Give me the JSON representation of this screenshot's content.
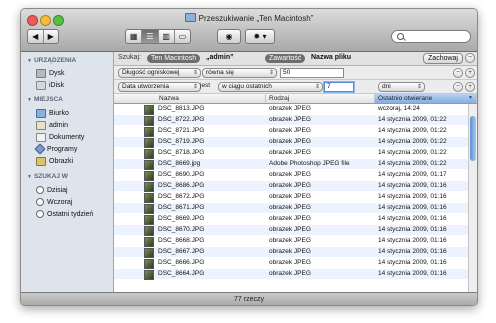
{
  "window": {
    "title": "Przeszukiwanie „Ten Macintosh”"
  },
  "toolbar": {
    "back_icon": "back-arrow",
    "forward_icon": "forward-arrow",
    "view_modes": [
      "icon-view",
      "list-view",
      "column-view",
      "coverflow-view"
    ],
    "selected_view": "list-view",
    "quicklook_icon": "eye-icon",
    "action_icon": "gear-icon",
    "search_placeholder": ""
  },
  "sidebar": {
    "sections": [
      {
        "header": "URZĄDZENIA",
        "items": [
          {
            "label": "Dysk",
            "icon": "hard-disk-icon"
          },
          {
            "label": "iDisk",
            "icon": "idisk-icon"
          }
        ]
      },
      {
        "header": "MIEJSCA",
        "items": [
          {
            "label": "Biurko",
            "icon": "desktop-icon"
          },
          {
            "label": "admin",
            "icon": "home-icon"
          },
          {
            "label": "Dokumenty",
            "icon": "documents-icon"
          },
          {
            "label": "Programy",
            "icon": "applications-icon"
          },
          {
            "label": "Obrazki",
            "icon": "pictures-icon"
          }
        ]
      },
      {
        "header": "SZUKAJ W",
        "items": [
          {
            "label": "Dzisiaj",
            "icon": "clock-icon"
          },
          {
            "label": "Wczoraj",
            "icon": "clock-icon"
          },
          {
            "label": "Ostatni tydzień",
            "icon": "clock-icon"
          }
        ]
      }
    ]
  },
  "scope": {
    "label": "Szukaj:",
    "options": [
      "Ten Macintosh",
      "„admin”"
    ],
    "selected": "Ten Macintosh",
    "attr_options": [
      "Zawartość",
      "Nazwa pliku"
    ],
    "attr_selected": "Zawartość",
    "save_label": "Zachowaj",
    "minus": "−"
  },
  "criteria": [
    {
      "attr": "Długość ogniskowej",
      "op": "równa się",
      "value": "50",
      "unit": ""
    },
    {
      "attr": "Data utworzenia",
      "op": "jest",
      "op2": "w ciągu ostatnich",
      "value": "7",
      "unit": "dni"
    }
  ],
  "criteria_buttons": {
    "minus": "−",
    "plus": "+"
  },
  "columns": [
    "Nazwa",
    "Rodzaj",
    "Ostatnio otwierane"
  ],
  "sorted_column": "Ostatnio otwierane",
  "rows": [
    {
      "name": "DSC_8813.JPG",
      "kind": "obrazek JPEG",
      "opened": "wczoraj, 14:24"
    },
    {
      "name": "DSC_8722.JPG",
      "kind": "obrazek JPEG",
      "opened": "14 stycznia 2009, 01:22"
    },
    {
      "name": "DSC_8721.JPG",
      "kind": "obrazek JPEG",
      "opened": "14 stycznia 2009, 01:22"
    },
    {
      "name": "DSC_8719.JPG",
      "kind": "obrazek JPEG",
      "opened": "14 stycznia 2009, 01:22"
    },
    {
      "name": "DSC_8718.JPG",
      "kind": "obrazek JPEG",
      "opened": "14 stycznia 2009, 01:22"
    },
    {
      "name": "DSC_8669.jpg",
      "kind": "Adobe Photoshop JPEG file",
      "opened": "14 stycznia 2009, 01:22"
    },
    {
      "name": "DSC_8690.JPG",
      "kind": "obrazek JPEG",
      "opened": "14 stycznia 2009, 01:17"
    },
    {
      "name": "DSC_8686.JPG",
      "kind": "obrazek JPEG",
      "opened": "14 stycznia 2009, 01:16"
    },
    {
      "name": "DSC_8672.JPG",
      "kind": "obrazek JPEG",
      "opened": "14 stycznia 2009, 01:16"
    },
    {
      "name": "DSC_8671.JPG",
      "kind": "obrazek JPEG",
      "opened": "14 stycznia 2009, 01:16"
    },
    {
      "name": "DSC_8669.JPG",
      "kind": "obrazek JPEG",
      "opened": "14 stycznia 2009, 01:16"
    },
    {
      "name": "DSC_8670.JPG",
      "kind": "obrazek JPEG",
      "opened": "14 stycznia 2009, 01:16"
    },
    {
      "name": "DSC_8668.JPG",
      "kind": "obrazek JPEG",
      "opened": "14 stycznia 2009, 01:16"
    },
    {
      "name": "DSC_8667.JPG",
      "kind": "obrazek JPEG",
      "opened": "14 stycznia 2009, 01:16"
    },
    {
      "name": "DSC_8666.JPG",
      "kind": "obrazek JPEG",
      "opened": "14 stycznia 2009, 01:16"
    },
    {
      "name": "DSC_8664.JPG",
      "kind": "obrazek JPEG",
      "opened": "14 stycznia 2009, 01:16"
    }
  ],
  "status": {
    "count": "77 rzeczy"
  },
  "colors": {
    "sidebar_bg": "#dde4ec",
    "selection_blue": "#86aee2",
    "alt_row": "#edf3fe"
  }
}
